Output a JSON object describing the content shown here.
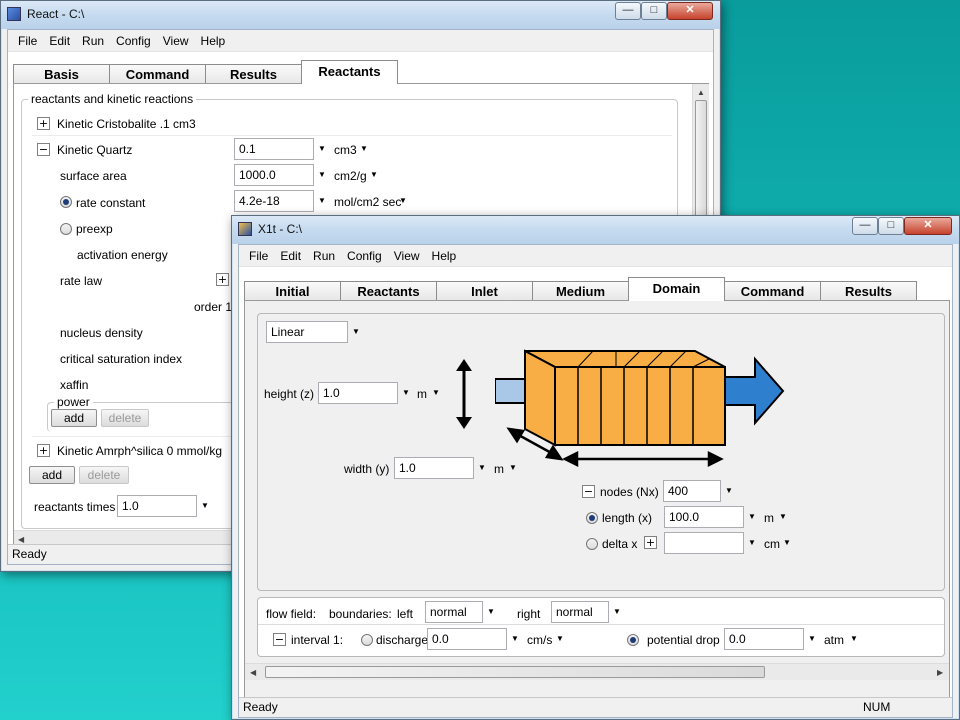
{
  "react_window": {
    "title": "React - C:\\",
    "menu": [
      "File",
      "Edit",
      "Run",
      "Config",
      "View",
      "Help"
    ],
    "tabs": [
      "Basis",
      "Command",
      "Results",
      "Reactants"
    ],
    "active_tab": "Reactants",
    "group_label": "reactants and kinetic reactions",
    "reactant1": "Kinetic Cristobalite .1 cm3",
    "reactant2": "Kinetic  Quartz",
    "quartz_amount": "0.1",
    "quartz_amount_unit": "cm3",
    "surface_area_label": "surface area",
    "surface_area": "1000.0",
    "surface_area_unit": "cm2/g",
    "rate_constant_label": "rate constant",
    "rate_constant": "4.2e-18",
    "rate_constant_unit": "mol/cm2 sec",
    "preexp_label": "preexp",
    "activation_energy_label": "activation energy",
    "rate_law_label": "rate law",
    "order_label": "order 1",
    "nucleus_density_label": "nucleus density",
    "critical_saturation_label": "critical saturation index",
    "xaffin_label": "xaffin",
    "power_label": "power",
    "add_label": "add",
    "delete_label": "delete",
    "reactant3": "Kinetic Amrph^silica 0 mmol/kg",
    "reactants_times_label": "reactants times",
    "reactants_times": "1.0",
    "status": "Ready"
  },
  "x1t_window": {
    "title": "X1t - C:\\",
    "menu": [
      "File",
      "Edit",
      "Run",
      "Config",
      "View",
      "Help"
    ],
    "tabs": [
      "Initial",
      "Reactants",
      "Inlet",
      "Medium",
      "Domain",
      "Command",
      "Results"
    ],
    "active_tab": "Domain",
    "geometry": "Linear",
    "height_label": "height (z)",
    "height": "1.0",
    "height_unit": "m",
    "width_label": "width (y)",
    "width": "1.0",
    "width_unit": "m",
    "nodes_label": "nodes (Nx)",
    "nodes": "400",
    "length_label": "length (x)",
    "length": "100.0",
    "length_unit": "m",
    "delta_label": "delta x",
    "delta": "",
    "delta_unit": "cm",
    "flow_field_label": "flow field:",
    "boundaries_label": "boundaries:",
    "left_label": "left",
    "left_value": "normal",
    "right_label": "right",
    "right_value": "normal",
    "interval_label": "interval 1:",
    "discharge_label": "discharge",
    "discharge": "0.0",
    "discharge_unit": "cm/s",
    "potential_drop_label": "potential drop",
    "potential_drop": "0.0",
    "potential_drop_unit": "atm",
    "status": "Ready",
    "status_right": "NUM"
  },
  "colors": {
    "block_fill": "#f8ae45",
    "arrow_blue": "#2f7fcf",
    "inlet_blue": "#a9c8e8"
  }
}
